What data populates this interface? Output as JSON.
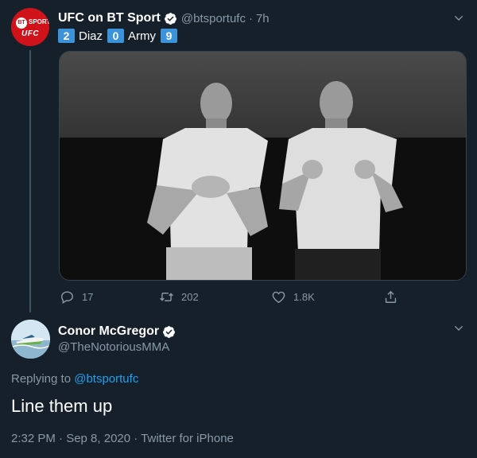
{
  "tweet": {
    "display_name": "UFC on BT Sport",
    "handle": "@btsportufc",
    "separator": "·",
    "time_ago": "7h",
    "avatar": {
      "badge": "BT",
      "sport": "SPORT",
      "mark": "UFC"
    },
    "score": {
      "left_num": "2",
      "left_name": "Diaz",
      "mid_num": "0",
      "right_name": "Army",
      "right_num": "9"
    },
    "photo_icon": "black-and-white-photo-two-fighters",
    "actions": {
      "replies": "17",
      "retweets": "202",
      "likes": "1.8K"
    }
  },
  "reply": {
    "display_name": "Conor McGregor",
    "handle": "@TheNotoriousMMA",
    "replying_prefix": "Replying to",
    "replying_to": "@btsportufc",
    "text": "Line them up",
    "timestamp": "2:32 PM · Sep 8, 2020 · Twitter for iPhone"
  },
  "colors": {
    "background": "#15202b",
    "accent": "#1da1f2",
    "muted": "#8899a6",
    "score_box": "#3b94d9",
    "avatar_red": "#d0121b"
  }
}
